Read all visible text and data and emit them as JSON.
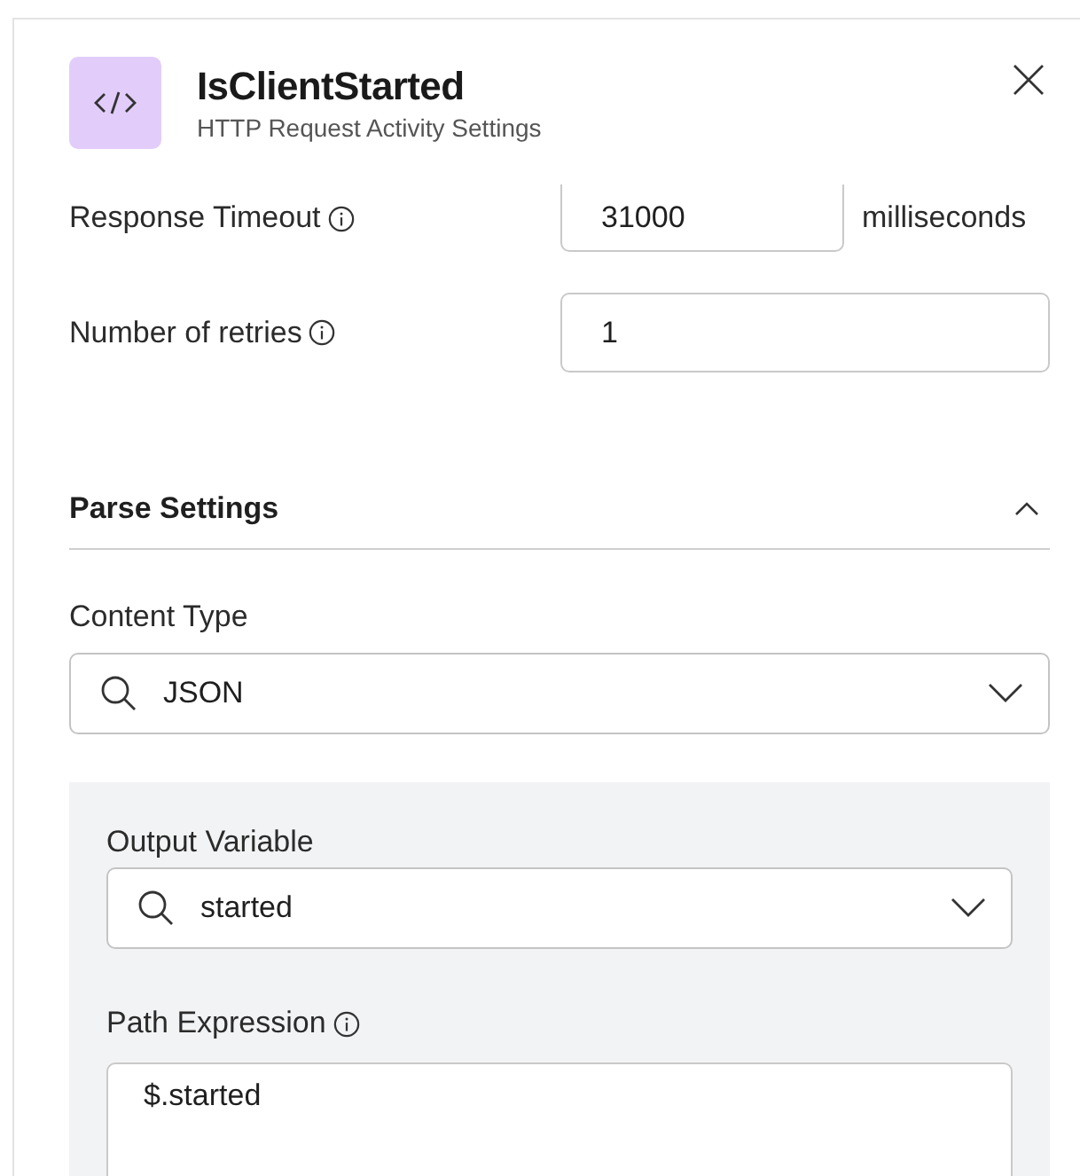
{
  "header": {
    "title": "IsClientStarted",
    "subtitle": "HTTP Request Activity Settings"
  },
  "fields": [
    {
      "label": "Response Timeout",
      "value": "31000",
      "unit": "milliseconds",
      "info": true
    },
    {
      "label": "Number of retries",
      "value": "1",
      "info": true
    }
  ],
  "parse_settings": {
    "title": "Parse Settings",
    "expanded": true,
    "content_type": {
      "label": "Content Type",
      "value": "JSON"
    },
    "output_variable": {
      "label": "Output Variable",
      "value": "started"
    },
    "path_expression": {
      "label": "Path Expression",
      "value": "$.started",
      "info": true
    }
  }
}
